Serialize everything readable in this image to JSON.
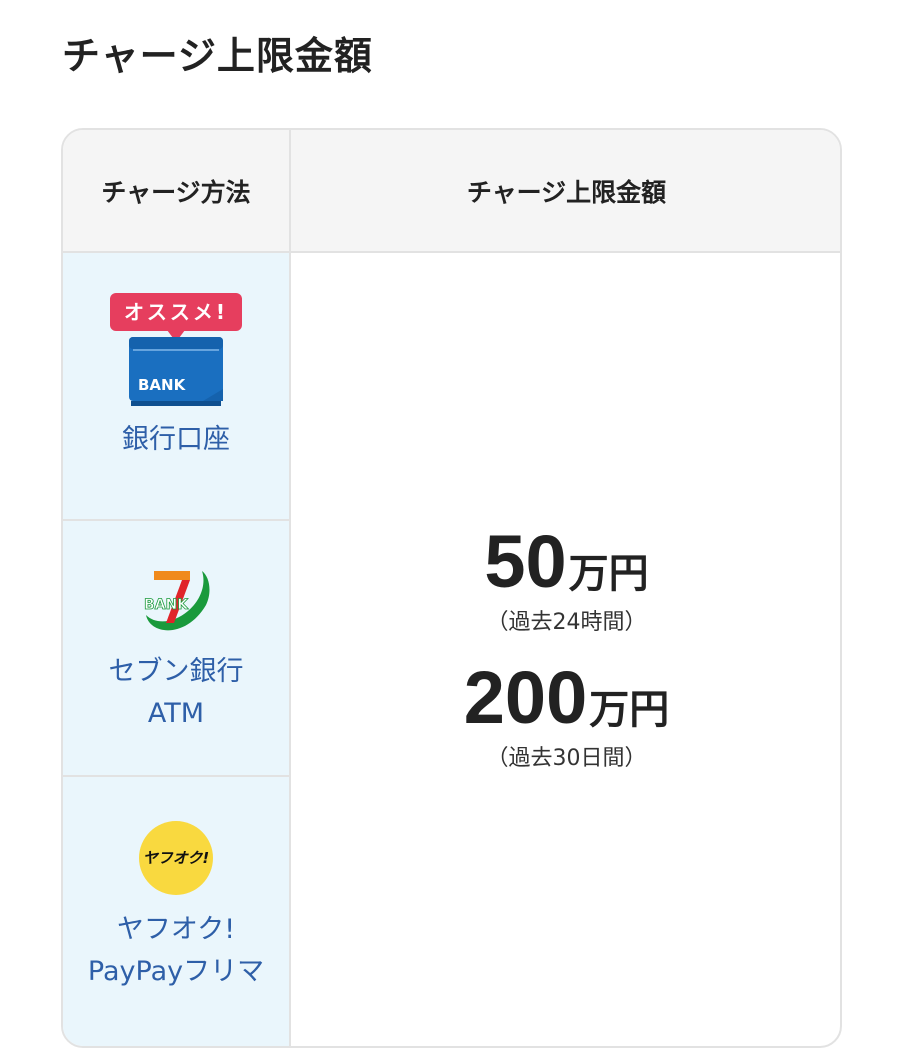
{
  "page": {
    "title": "チャージ上限金額"
  },
  "table": {
    "headers": {
      "method": "チャージ方法",
      "limit": "チャージ上限金額"
    },
    "methods": [
      {
        "badge": "オススメ!",
        "icon": "bank-book-icon",
        "icon_text": "BANK",
        "label_line1": "銀行口座",
        "label_line2": ""
      },
      {
        "badge": "",
        "icon": "seven-bank-logo-icon",
        "icon_text": "BANK",
        "label_line1": "セブン銀行",
        "label_line2": "ATM"
      },
      {
        "badge": "",
        "icon": "yahuoku-logo-icon",
        "icon_text": "ヤフオク!",
        "label_line1": "ヤフオク!",
        "label_line2": "PayPayフリマ"
      }
    ],
    "limits": [
      {
        "amount": "50",
        "unit": "万円",
        "note": "（過去24時間）"
      },
      {
        "amount": "200",
        "unit": "万円",
        "note": "（過去30日間）"
      }
    ]
  },
  "colors": {
    "method_bg": "#eaf6fc",
    "method_text": "#2e5fa8",
    "badge": "#e63e5e",
    "bank_blue": "#1a6fc0",
    "yahoo_yellow": "#f9d93f",
    "seven_green": "#1a9a3c",
    "seven_orange": "#f08a1c",
    "seven_red": "#e0242a"
  }
}
